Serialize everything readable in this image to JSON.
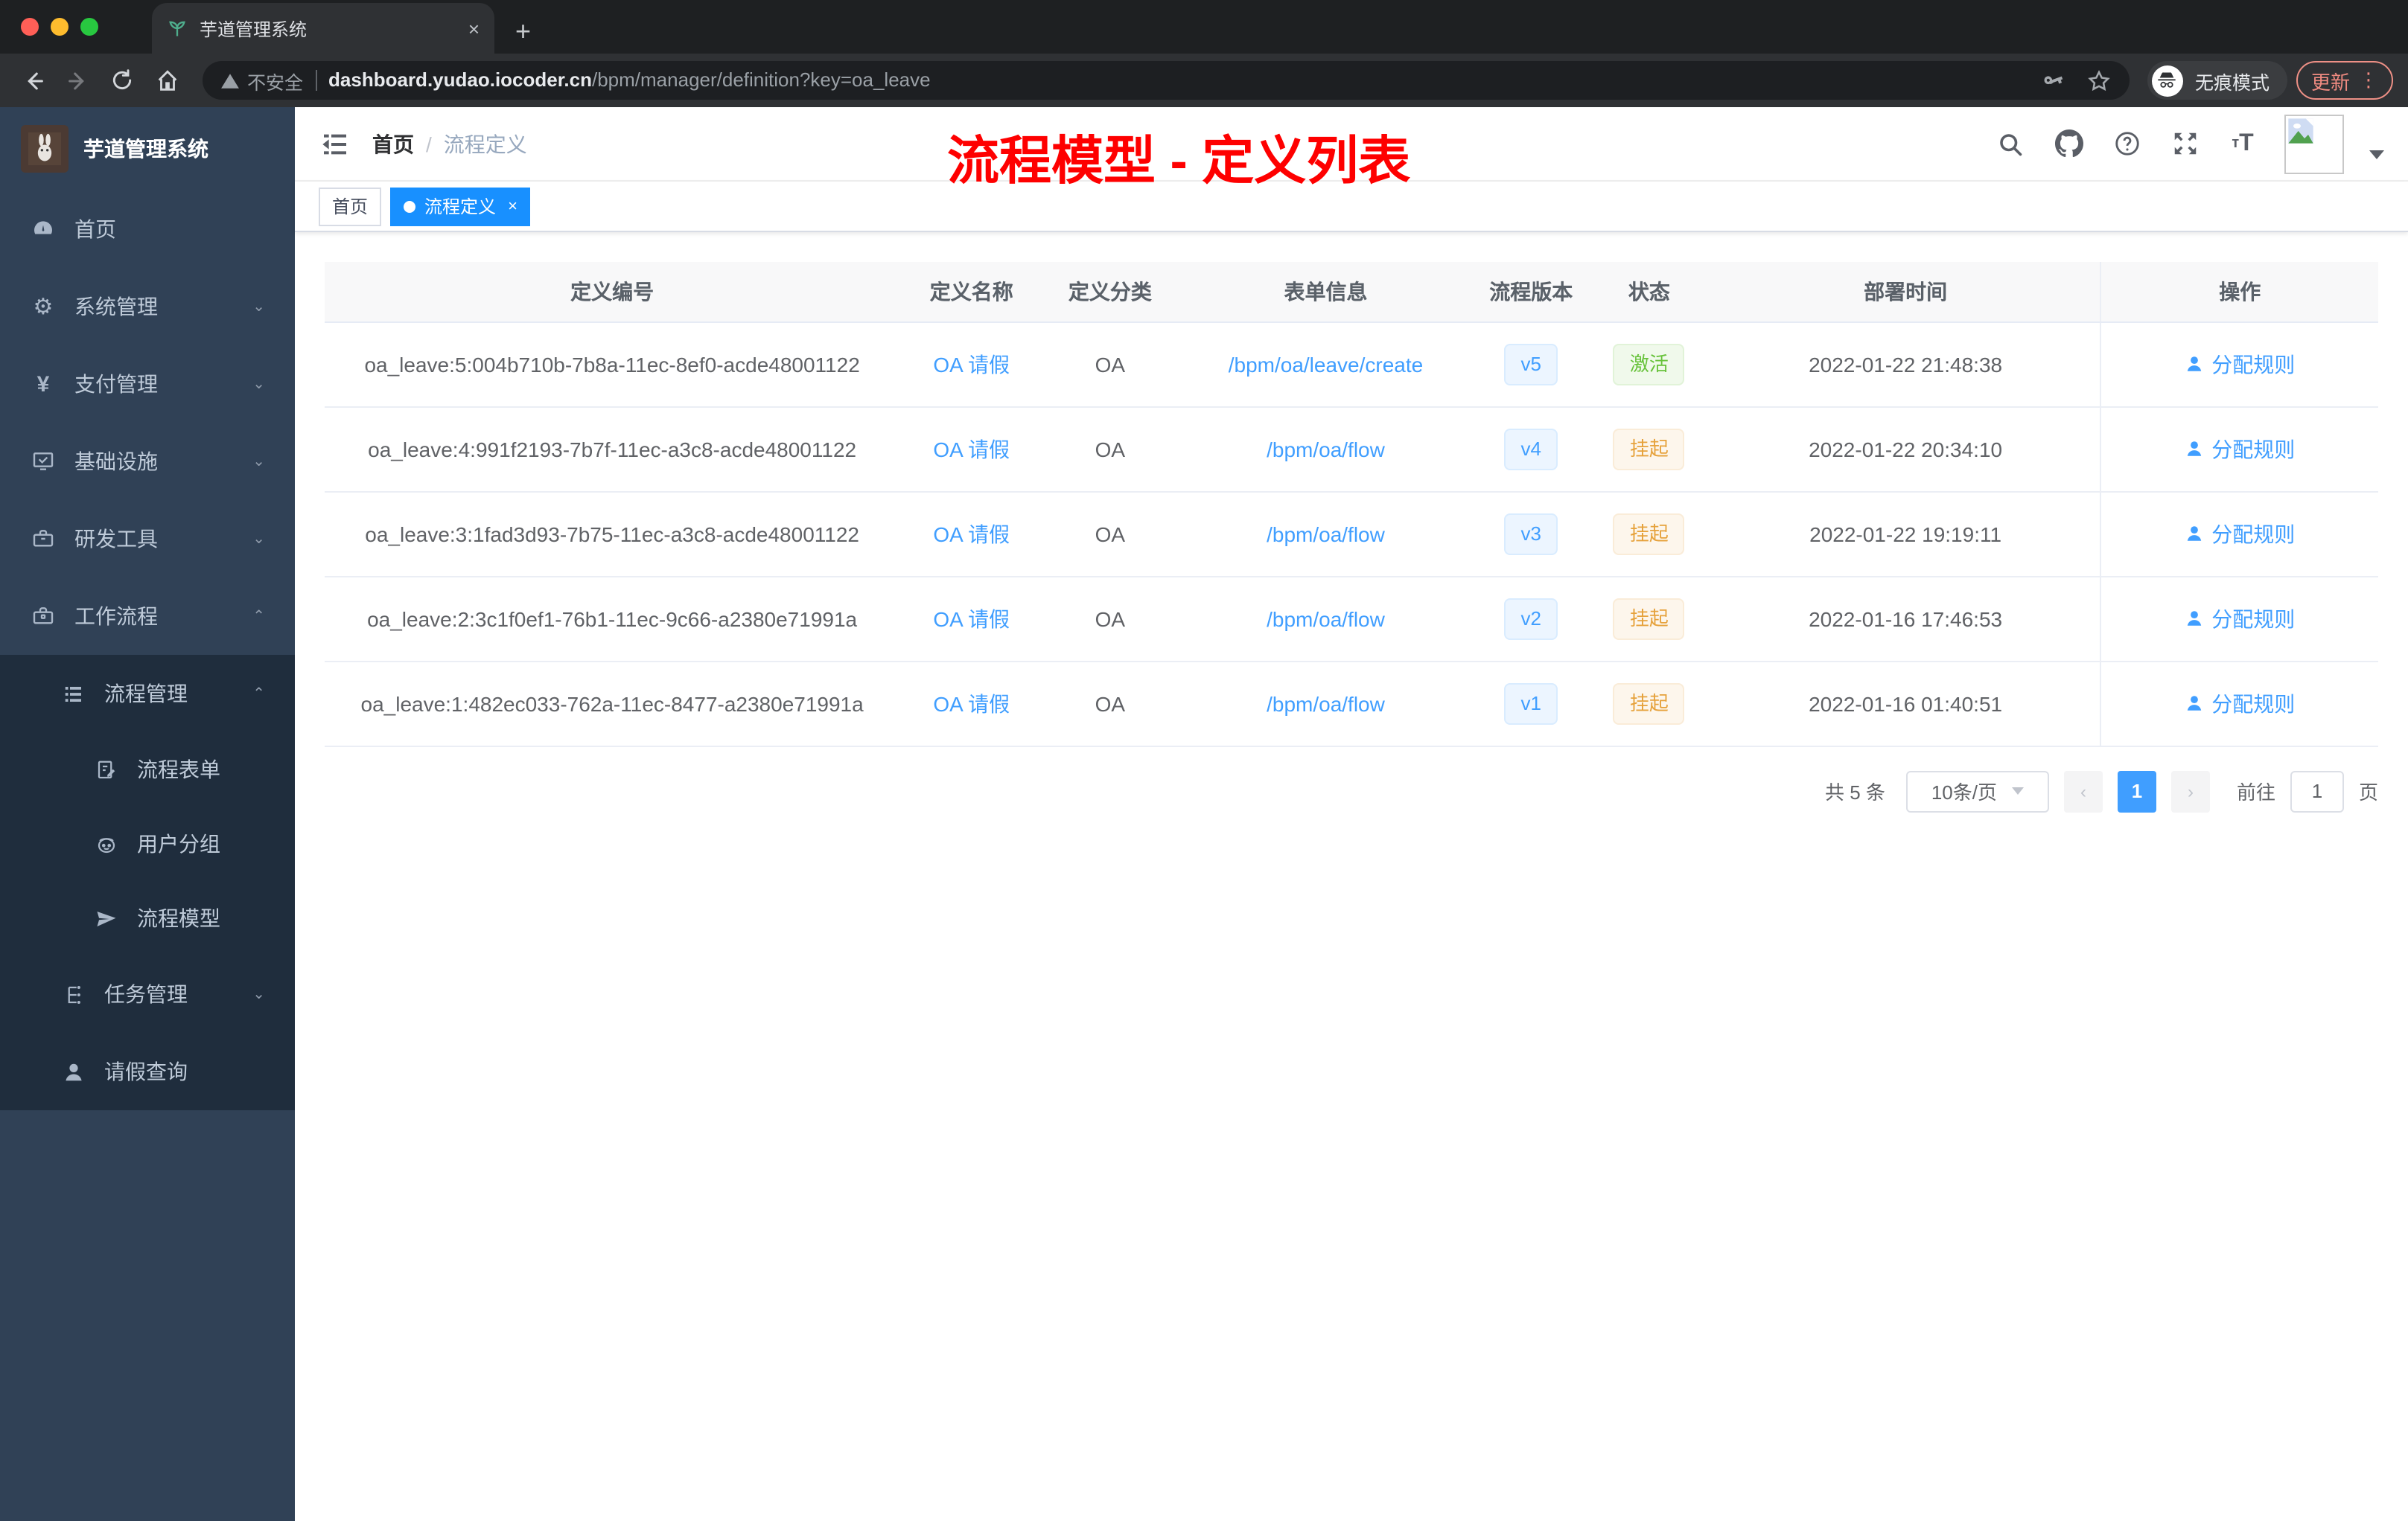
{
  "browser": {
    "tab_title": "芋道管理系统",
    "tab_close": "×",
    "new_tab": "+",
    "security_label": "不安全",
    "url_host": "dashboard.yudao.iocoder.cn",
    "url_path": "/bpm/manager/definition?key=oa_leave",
    "incognito_label": "无痕模式",
    "update_label": "更新",
    "kebab": "⋮"
  },
  "sidebar": {
    "title": "芋道管理系统",
    "items": [
      {
        "label": "首页"
      },
      {
        "label": "系统管理"
      },
      {
        "label": "支付管理"
      },
      {
        "label": "基础设施"
      },
      {
        "label": "研发工具"
      },
      {
        "label": "工作流程"
      },
      {
        "label": "流程管理"
      },
      {
        "label": "流程表单"
      },
      {
        "label": "用户分组"
      },
      {
        "label": "流程模型"
      },
      {
        "label": "任务管理"
      },
      {
        "label": "请假查询"
      }
    ]
  },
  "header": {
    "breadcrumb_home": "首页",
    "breadcrumb_sep": "/",
    "breadcrumb_current": "流程定义",
    "annotation": "流程模型 - 定义列表",
    "font_size_icon_text": "тT"
  },
  "tags": [
    {
      "label": "首页"
    },
    {
      "label": "流程定义",
      "close": "×"
    }
  ],
  "table": {
    "columns": [
      "定义编号",
      "定义名称",
      "定义分类",
      "表单信息",
      "流程版本",
      "状态",
      "部署时间",
      "操作"
    ],
    "rows": [
      {
        "id": "oa_leave:5:004b710b-7b8a-11ec-8ef0-acde48001122",
        "name": "OA 请假",
        "category": "OA",
        "form": "/bpm/oa/leave/create",
        "version": "v5",
        "status": "激活",
        "time": "2022-01-22 21:48:38",
        "action": "分配规则"
      },
      {
        "id": "oa_leave:4:991f2193-7b7f-11ec-a3c8-acde48001122",
        "name": "OA 请假",
        "category": "OA",
        "form": "/bpm/oa/flow",
        "version": "v4",
        "status": "挂起",
        "time": "2022-01-22 20:34:10",
        "action": "分配规则"
      },
      {
        "id": "oa_leave:3:1fad3d93-7b75-11ec-a3c8-acde48001122",
        "name": "OA 请假",
        "category": "OA",
        "form": "/bpm/oa/flow",
        "version": "v3",
        "status": "挂起",
        "time": "2022-01-22 19:19:11",
        "action": "分配规则"
      },
      {
        "id": "oa_leave:2:3c1f0ef1-76b1-11ec-9c66-a2380e71991a",
        "name": "OA 请假",
        "category": "OA",
        "form": "/bpm/oa/flow",
        "version": "v2",
        "status": "挂起",
        "time": "2022-01-16 17:46:53",
        "action": "分配规则"
      },
      {
        "id": "oa_leave:1:482ec033-762a-11ec-8477-a2380e71991a",
        "name": "OA 请假",
        "category": "OA",
        "form": "/bpm/oa/flow",
        "version": "v1",
        "status": "挂起",
        "time": "2022-01-16 01:40:51",
        "action": "分配规则"
      }
    ]
  },
  "pagination": {
    "total": "共 5 条",
    "page_size": "10条/页",
    "prev": "‹",
    "current": "1",
    "next": "›",
    "goto": "前往",
    "goto_value": "1",
    "page_suffix": "页"
  },
  "colors": {
    "accent": "#409eff",
    "tag_active": "#1890ff",
    "status_active": "#67c23a",
    "status_suspended": "#e6a23c",
    "annotation_red": "#fe0000",
    "sidebar_bg": "#304156",
    "submenu_bg": "#1f2d3d"
  }
}
